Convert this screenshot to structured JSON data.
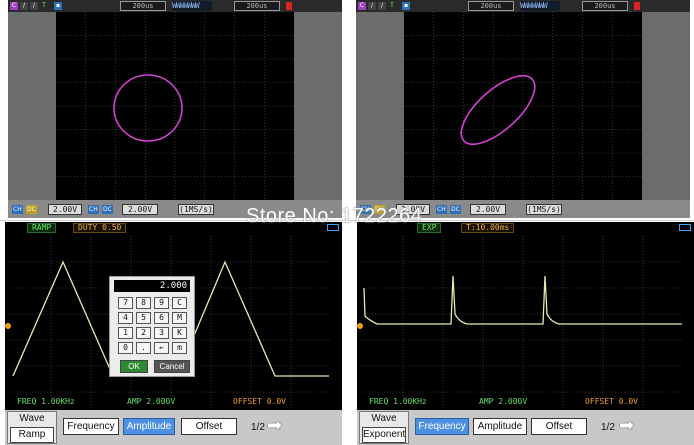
{
  "scope_left": {
    "top_boxes": [
      "200us",
      "200us"
    ],
    "wave_label": "WWWWWWW",
    "bottom_boxes": [
      "2.00V",
      "2.00V",
      "(1MS/s)"
    ]
  },
  "scope_right": {
    "top_boxes": [
      "200us",
      "200us"
    ],
    "wave_label": "WWWWWWW",
    "bottom_boxes": [
      "2.00V",
      "2.00V",
      "(1MS/s)"
    ]
  },
  "watermark": "Store No: 1722264",
  "gen_left": {
    "header": {
      "wave": "RAMP",
      "param": "DUTY 0.50"
    },
    "info": {
      "freq": "FREQ 1.00KHz",
      "amp": "AMP 2.000V",
      "offset": "OFFSET 0.0V"
    },
    "menu": {
      "wave_label": "Wave",
      "wave_value": "Ramp",
      "buttons": [
        "Frequency",
        "Amplitude",
        "Offset"
      ],
      "active": "Amplitude",
      "page": "1/2"
    },
    "keypad": {
      "display": "2.000",
      "keys": [
        "7",
        "8",
        "9",
        "C",
        "4",
        "5",
        "6",
        "M",
        "1",
        "2",
        "3",
        "K",
        "0",
        ".",
        "←",
        "m"
      ],
      "ok": "OK",
      "cancel": "Cancel"
    }
  },
  "gen_right": {
    "header": {
      "wave": "EXP",
      "param": "T:10.00ms"
    },
    "info": {
      "freq": "FREQ 1.00KHz",
      "amp": "AMP 2.000V",
      "offset": "OFFSET 0.0V"
    },
    "menu": {
      "wave_label": "Wave",
      "wave_value": "Exponent",
      "buttons": [
        "Frequency",
        "Amplitude",
        "Offset"
      ],
      "active": "Frequency",
      "page": "1/2"
    }
  },
  "icons": {
    "arrow": "arrow-right-icon",
    "battery": "battery-icon"
  },
  "colors": {
    "trace_scope": "#d040d0",
    "trace_gen": "#e8e8b0",
    "active_button": "#4d8fe0",
    "grid": "#5a5a5a"
  }
}
